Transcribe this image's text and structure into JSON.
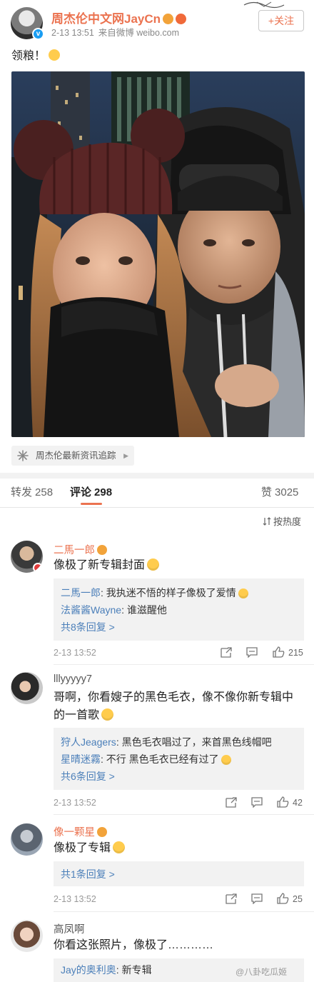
{
  "post": {
    "author": "周杰伦中文网JayCn",
    "time": "2-13 13:51",
    "source": "来自微博 weibo.com",
    "follow_label": "+关注",
    "text": "领粮！",
    "photo_icon": "selfie-photo",
    "source_tag": "周杰伦最新资讯追踪",
    "source_tag_arrow": "▶"
  },
  "tabs": {
    "repost_label": "转发",
    "repost_count": "258",
    "comment_label": "评论",
    "comment_count": "298",
    "like_label": "赞",
    "like_count": "3025"
  },
  "sort": {
    "label": "按热度"
  },
  "comments": [
    {
      "name": "二馬一郎",
      "text": "像极了新专辑封面",
      "replies": [
        {
          "name": "二馬一郎",
          "sep": ": ",
          "text": "我执迷不悟的样子像极了爱情"
        },
        {
          "name": "法酱酱Wayne",
          "sep": ": ",
          "text": "谁滋醒他"
        }
      ],
      "more": "共8条回复 >",
      "time": "2-13 13:52",
      "likes": "215"
    },
    {
      "name": "lllyyyyy7",
      "text": "哥啊，你看嫂子的黑色毛衣，像不像你新专辑中的一首歌",
      "replies": [
        {
          "name": "狩人Jeagers",
          "sep": ": ",
          "text": "黑色毛衣唱过了，来首黑色线帽吧"
        },
        {
          "name": "星晴迷霧",
          "sep": ": ",
          "text": "不行 黑色毛衣已经有过了"
        }
      ],
      "more": "共6条回复 >",
      "time": "2-13 13:52",
      "likes": "42"
    },
    {
      "name": "像一颗星",
      "text": "像极了专辑",
      "more": "共1条回复 >",
      "time": "2-13 13:52",
      "likes": "25"
    },
    {
      "name": "高凤啊",
      "text": "你看这张照片，像极了…………",
      "replies": [
        {
          "name": "Jay的奥利奥",
          "sep": ": ",
          "text": "新专辑"
        }
      ]
    }
  ],
  "watermark": "@八卦吃瓜姬",
  "colors": {
    "accent": "#eb7350",
    "link": "#4b7fb9",
    "gray_bg": "#f2f2f2"
  }
}
